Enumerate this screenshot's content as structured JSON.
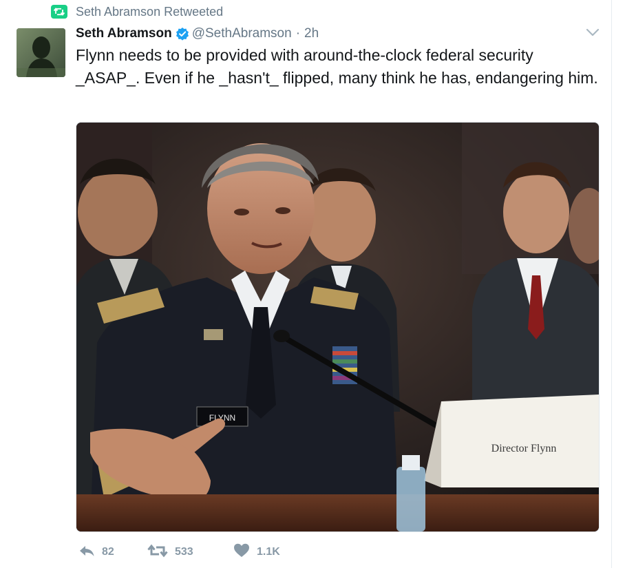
{
  "retweet_banner": {
    "label": "Seth Abramson Retweeted"
  },
  "tweet": {
    "author_name": "Seth Abramson",
    "handle": "@SethAbramson",
    "separator": "·",
    "timestamp": "2h",
    "text": "Flynn needs to be provided with around-the-clock federal security _ASAP_. Even if he _hasn't_ flipped, many think he has, endangering him.",
    "media": {
      "nameplate_text": "FLYNN",
      "placard_text": "Director Flynn"
    },
    "actions": {
      "reply_count": "82",
      "retweet_count": "533",
      "like_count": "1.1K"
    }
  },
  "colors": {
    "retweet_green": "#19cf86",
    "verified_blue": "#1da1f2",
    "muted_text": "#657786",
    "action_gray": "#8899a6"
  },
  "icons": [
    "retweet-icon",
    "verified-badge-icon",
    "chevron-down-icon",
    "reply-icon",
    "retweet-icon",
    "heart-icon"
  ]
}
